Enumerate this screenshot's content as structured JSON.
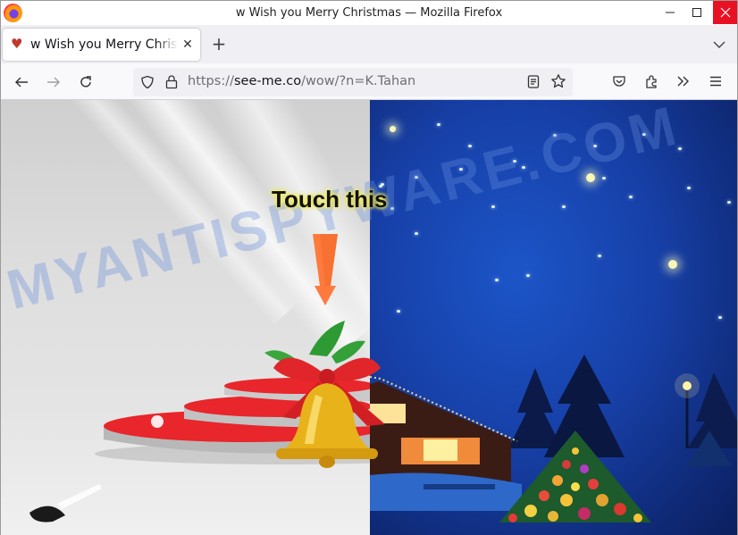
{
  "window": {
    "title": "w Wish you Merry Christmas — Mozilla Firefox",
    "controls": {
      "minimize": "—",
      "maximize": "☐",
      "close": "✕"
    },
    "close_color": "#e81123"
  },
  "tabs": [
    {
      "label": "w Wish you Merry Christmas",
      "favicon": "heart-icon",
      "active": true
    }
  ],
  "tabstrip": {
    "new_tab": "+"
  },
  "navbar": {
    "url_prefix": "https://",
    "url_host": "see-me.co",
    "url_path": "/wow/?n=K.Tahan",
    "icons": [
      "back-arrow-icon",
      "forward-arrow-icon",
      "reload-icon",
      "shield-icon",
      "lock-icon",
      "reader-view-icon",
      "bookmark-star-icon",
      "pocket-icon",
      "extensions-icon",
      "overflow-chevrons-icon",
      "hamburger-menu-icon"
    ]
  },
  "page": {
    "call_to_action": "Touch this",
    "watermark": "MYANTISPYWARE.COM",
    "colors": {
      "arrow": "#ff7a3c",
      "stage_red": "#e8262b",
      "bell_gold": "#e8b21a",
      "sky_blue": "#1a4bbf",
      "cta_glow": "#f6f05a"
    }
  }
}
